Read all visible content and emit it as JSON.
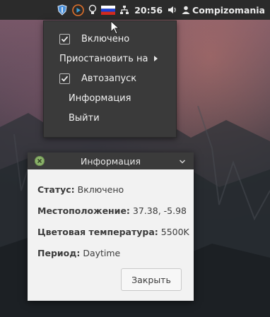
{
  "panel": {
    "tray_icons": [
      "shield-icon",
      "play-icon",
      "lightbulb-icon",
      "russian-flag-icon",
      "network-icon"
    ],
    "clock": "20:56",
    "volume_icon": "speaker-icon",
    "user_icon": "user-icon",
    "username": "Compizomania"
  },
  "menu": {
    "items": [
      {
        "label": "Включено",
        "checked": true
      },
      {
        "label": "Приостановить на",
        "submenu": true
      },
      {
        "label": "Автозапуск",
        "checked": true
      },
      {
        "label": "Информация"
      },
      {
        "label": "Выйти"
      }
    ]
  },
  "dialog": {
    "title": "Информация",
    "status_key": "Статус:",
    "status_value": "Включено",
    "location_key": "Местоположение:",
    "location_value": "37.38, -5.98",
    "temp_key": "Цветовая температура:",
    "temp_value": "5500K",
    "period_key": "Период:",
    "period_value": "Daytime",
    "close_label": "Закрыть"
  },
  "colors": {
    "panel_bg": "#2b2b2b",
    "menu_bg": "#3a3a3a",
    "dialog_titlebar": "#3b3b3b",
    "dialog_content": "#f2f2f2",
    "close_button_green": "#8bb26a"
  }
}
